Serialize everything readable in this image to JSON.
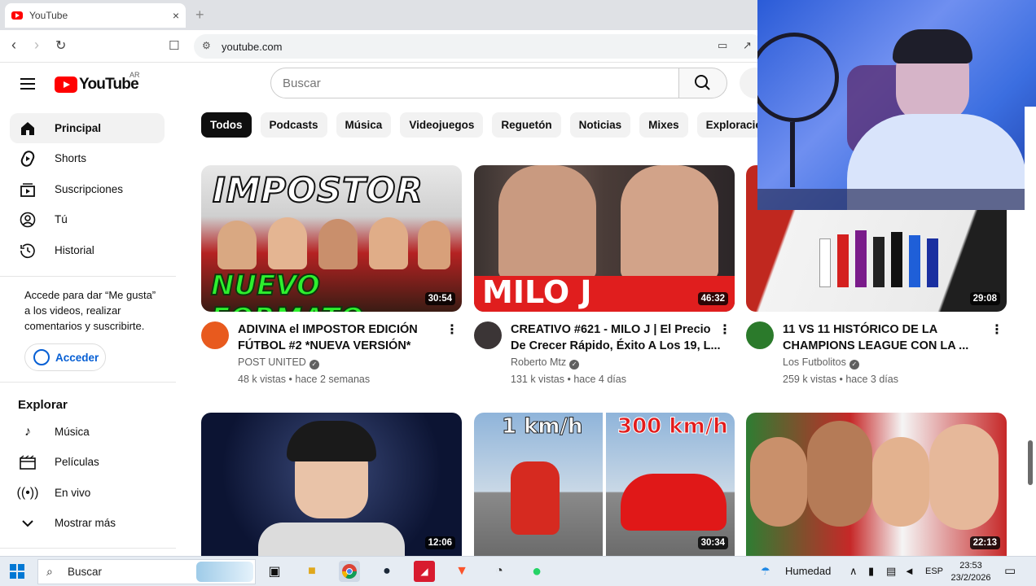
{
  "browser": {
    "tab_title": "YouTube",
    "tab_close": "×",
    "new_tab": "+",
    "url": "youtube.com"
  },
  "header": {
    "logo_text": "YouTube",
    "country_code": "AR",
    "search_placeholder": "Buscar"
  },
  "sidebar": {
    "main_items": [
      {
        "label": "Principal",
        "icon": "home-icon"
      },
      {
        "label": "Shorts",
        "icon": "shorts-icon"
      },
      {
        "label": "Suscripciones",
        "icon": "subscriptions-icon"
      },
      {
        "label": "Tú",
        "icon": "user-icon"
      },
      {
        "label": "Historial",
        "icon": "history-icon"
      }
    ],
    "signin_prompt": "Accede para dar “Me gusta” a los videos, realizar comentarios y suscribirte.",
    "signin_button": "Acceder",
    "explore_heading": "Explorar",
    "explore_items": [
      {
        "label": "Música",
        "icon": "music-icon"
      },
      {
        "label": "Películas",
        "icon": "movies-icon"
      },
      {
        "label": "En vivo",
        "icon": "live-icon"
      },
      {
        "label": "Mostrar más",
        "icon": "chevron-down-icon"
      }
    ]
  },
  "chips": [
    "Todos",
    "Podcasts",
    "Música",
    "Videojuegos",
    "Reguetón",
    "Noticias",
    "Mixes",
    "Exploración urb"
  ],
  "videos": [
    {
      "title": "ADIVINA el IMPOSTOR EDICIÓN FÚTBOL #2 *NUEVA VERSIÓN*",
      "channel": "POST UNITED",
      "stats": "48 k vistas • hace 2 semanas",
      "duration": "30:54",
      "thumb_top": "IMPOSTOR",
      "thumb_bottom": "NUEVO FORMATO"
    },
    {
      "title": "CREATIVO #621 - MILO J | El Precio De Crecer Rápido, Éxito A Los 19, L...",
      "channel": "Roberto Mtz",
      "stats": "131 k vistas • hace 4 días",
      "duration": "46:32",
      "thumb_bottom": "MILO J"
    },
    {
      "title": "11 VS 11 HISTÓRICO DE LA CHAMPIONS LEAGUE CON LA ...",
      "channel": "Los Futbolitos",
      "stats": "259 k vistas • hace 3 días",
      "duration": "29:08"
    },
    {
      "title": "",
      "channel": "",
      "stats": "",
      "duration": "12:06"
    },
    {
      "title": "",
      "channel": "",
      "stats": "",
      "duration": "30:34",
      "thumb_left": "1 km/h",
      "thumb_right": "300 km/h"
    },
    {
      "title": "",
      "channel": "",
      "stats": "",
      "duration": "22:13"
    }
  ],
  "taskbar": {
    "search_label": "Buscar",
    "weather": "Humedad",
    "language": "ESP",
    "time": "23:53",
    "date": "23/2/2026"
  },
  "colors": {
    "youtube_red": "#ff0000",
    "link_blue": "#065fd4",
    "chip_active": "#0f0f0f"
  }
}
